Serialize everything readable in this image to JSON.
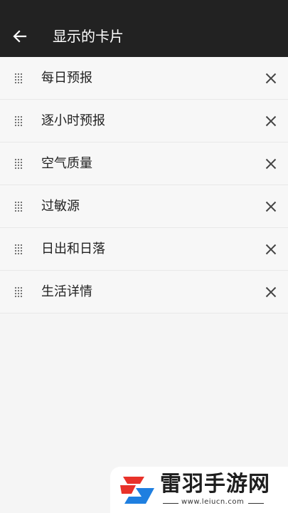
{
  "appbar": {
    "back_icon": "arrow-left-icon",
    "title": "显示的卡片"
  },
  "cards": [
    {
      "label": "每日预报"
    },
    {
      "label": "逐小时预报"
    },
    {
      "label": "空气质量"
    },
    {
      "label": "过敏源"
    },
    {
      "label": "日出和日落"
    },
    {
      "label": "生活详情"
    }
  ],
  "row_icons": {
    "drag": "drag-handle-icon",
    "remove": "close-icon"
  },
  "watermark": {
    "name": "雷羽手游网",
    "url": "www.leiucn.com"
  },
  "colors": {
    "appbar": "#222222",
    "background": "#f5f5f5",
    "text": "#222222",
    "logo_red": "#e8322a",
    "logo_blue": "#1f7fe0"
  }
}
